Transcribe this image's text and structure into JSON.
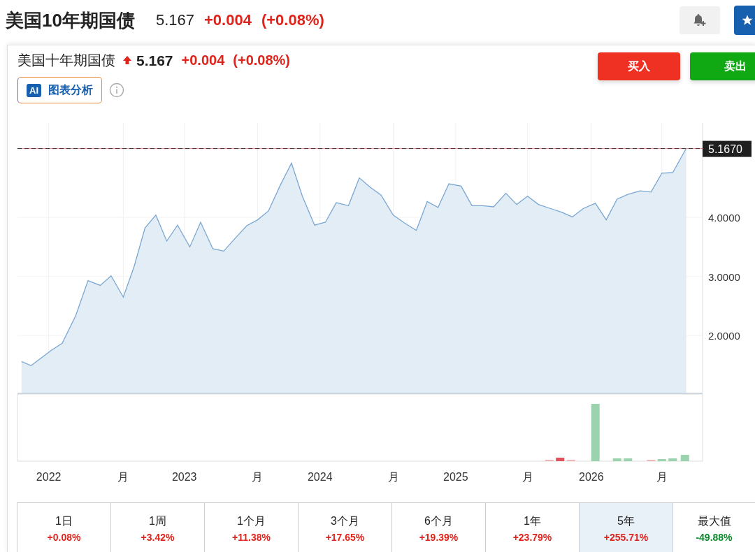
{
  "header": {
    "title": "美国10年期国债",
    "price": "5.167",
    "change": "+0.004",
    "change_percent": "(+0.08%)"
  },
  "instrument": {
    "name": "美国十年期国债",
    "price": "5.167",
    "change": "+0.004",
    "change_percent": "(+0.08%)",
    "ai_badge": "AI",
    "ai_button": "图表分析"
  },
  "actions": [
    {
      "label": "买入",
      "kind": "buy"
    },
    {
      "label": "卖出",
      "kind": "sell"
    }
  ],
  "chart": {
    "chart_data": {
      "type": "area",
      "grid": true,
      "ref_lines": [
        {
          "axis": "y",
          "value": 5.167,
          "color": "#ee8888"
        },
        {
          "axis": "y",
          "value": 5.167,
          "color": "#333333",
          "label": "5.1670"
        }
      ],
      "xlim": [
        2021.77,
        2026.82
      ],
      "ylim": [
        1.02,
        5.6
      ],
      "xticks": [
        {
          "value": 2022,
          "label": "2022"
        },
        {
          "value": 2022.55,
          "label": "月"
        },
        {
          "value": 2023,
          "label": "2023"
        },
        {
          "value": 2023.54,
          "label": "月"
        },
        {
          "value": 2024,
          "label": "2024"
        },
        {
          "value": 2024.54,
          "label": "月"
        },
        {
          "value": 2025,
          "label": "2025"
        },
        {
          "value": 2025.53,
          "label": "月"
        },
        {
          "value": 2026,
          "label": "2026"
        },
        {
          "value": 2026.52,
          "label": "月"
        }
      ],
      "yticks": [
        {
          "value": 2,
          "label": "2.0000"
        },
        {
          "value": 3,
          "label": "3.0000"
        },
        {
          "value": 4,
          "label": "4.0000"
        }
      ],
      "x": [
        2021.8,
        2021.87,
        2021.94,
        2022.02,
        2022.1,
        2022.2,
        2022.29,
        2022.38,
        2022.46,
        2022.55,
        2022.63,
        2022.71,
        2022.79,
        2022.87,
        2022.95,
        2023.04,
        2023.12,
        2023.21,
        2023.29,
        2023.38,
        2023.46,
        2023.54,
        2023.62,
        2023.71,
        2023.79,
        2023.87,
        2023.96,
        2024.04,
        2024.12,
        2024.21,
        2024.29,
        2024.37,
        2024.45,
        2024.54,
        2024.62,
        2024.71,
        2024.79,
        2024.87,
        2024.95,
        2025.04,
        2025.12,
        2025.2,
        2025.28,
        2025.37,
        2025.45,
        2025.53,
        2025.61,
        2025.7,
        2025.78,
        2025.86,
        2025.94,
        2026.03,
        2026.11,
        2026.19,
        2026.27,
        2026.36,
        2026.44,
        2026.52,
        2026.6,
        2026.7
      ],
      "series": [
        {
          "color": "#7aa7d2",
          "values": [
            1.56,
            1.49,
            1.61,
            1.75,
            1.87,
            2.34,
            2.93,
            2.85,
            3.01,
            2.65,
            3.17,
            3.82,
            4.04,
            3.6,
            3.87,
            3.5,
            3.92,
            3.47,
            3.43,
            3.66,
            3.86,
            3.96,
            4.11,
            4.56,
            4.92,
            4.36,
            3.87,
            3.92,
            4.25,
            4.2,
            4.67,
            4.51,
            4.38,
            4.04,
            3.91,
            3.78,
            4.27,
            4.17,
            4.57,
            4.53,
            4.2,
            4.2,
            4.18,
            4.41,
            4.22,
            4.36,
            4.22,
            4.15,
            4.09,
            4.01,
            4.15,
            4.24,
            3.96,
            4.31,
            4.39,
            4.45,
            4.43,
            4.75,
            4.76,
            5.17
          ]
        }
      ]
    }
  },
  "periods": [
    {
      "label": "1日",
      "change": "+0.08%",
      "color": "#e0231b",
      "selected": false
    },
    {
      "label": "1周",
      "change": "+3.42%",
      "color": "#e0231b",
      "selected": false
    },
    {
      "label": "1个月",
      "change": "+11.38%",
      "color": "#e0231b",
      "selected": false
    },
    {
      "label": "3个月",
      "change": "+17.65%",
      "color": "#e0231b",
      "selected": false
    },
    {
      "label": "6个月",
      "change": "+19.39%",
      "color": "#e0231b",
      "selected": false
    },
    {
      "label": "1年",
      "change": "+23.79%",
      "color": "#e0231b",
      "selected": false
    },
    {
      "label": "5年",
      "change": "+255.71%",
      "color": "#e0231b",
      "selected": true
    },
    {
      "label": "最大值",
      "change": "-49.88%",
      "color": "#0a8a2a",
      "selected": false
    }
  ]
}
